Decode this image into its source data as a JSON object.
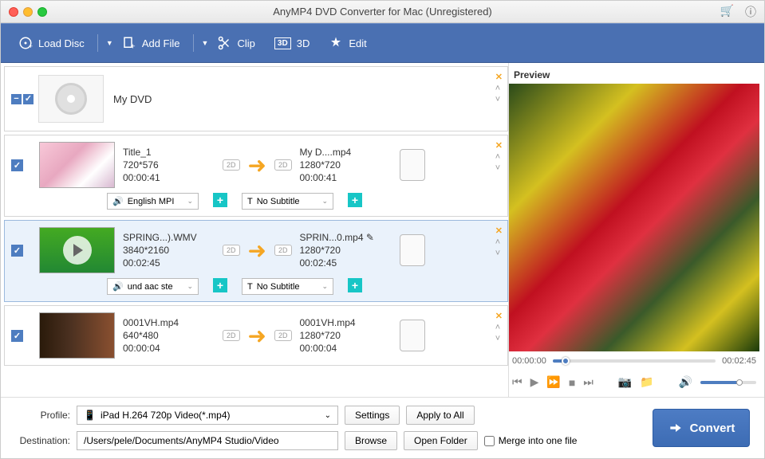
{
  "title": "AnyMP4 DVD Converter for Mac (Unregistered)",
  "toolbar": {
    "load_disc": "Load Disc",
    "add_file": "Add File",
    "clip": "Clip",
    "three_d": "3D",
    "edit": "Edit"
  },
  "group": {
    "title": "My DVD"
  },
  "items": [
    {
      "src_name": "Title_1",
      "src_res": "720*576",
      "src_dur": "00:00:41",
      "dst_name": "My D....mp4",
      "dst_res": "1280*720",
      "dst_dur": "00:00:41",
      "audio": "English MPI",
      "subtitle": "No Subtitle"
    },
    {
      "src_name": "SPRING...).WMV",
      "src_res": "3840*2160",
      "src_dur": "00:02:45",
      "dst_name": "SPRIN...0.mp4",
      "dst_res": "1280*720",
      "dst_dur": "00:02:45",
      "audio": "und aac ste",
      "subtitle": "No Subtitle"
    },
    {
      "src_name": "0001VH.mp4",
      "src_res": "640*480",
      "src_dur": "00:00:04",
      "dst_name": "0001VH.mp4",
      "dst_res": "1280*720",
      "dst_dur": "00:00:04",
      "audio": "",
      "subtitle": ""
    }
  ],
  "profile_label": "Profile:",
  "profile_value": "iPad H.264 720p Video(*.mp4)",
  "settings": "Settings",
  "apply_all": "Apply to All",
  "dest_label": "Destination:",
  "dest_value": "/Users/pele/Documents/AnyMP4 Studio/Video",
  "browse": "Browse",
  "open_folder": "Open Folder",
  "merge": "Merge into one file",
  "convert": "Convert",
  "preview": {
    "label": "Preview",
    "time_cur": "00:00:00",
    "time_end": "00:02:45"
  }
}
